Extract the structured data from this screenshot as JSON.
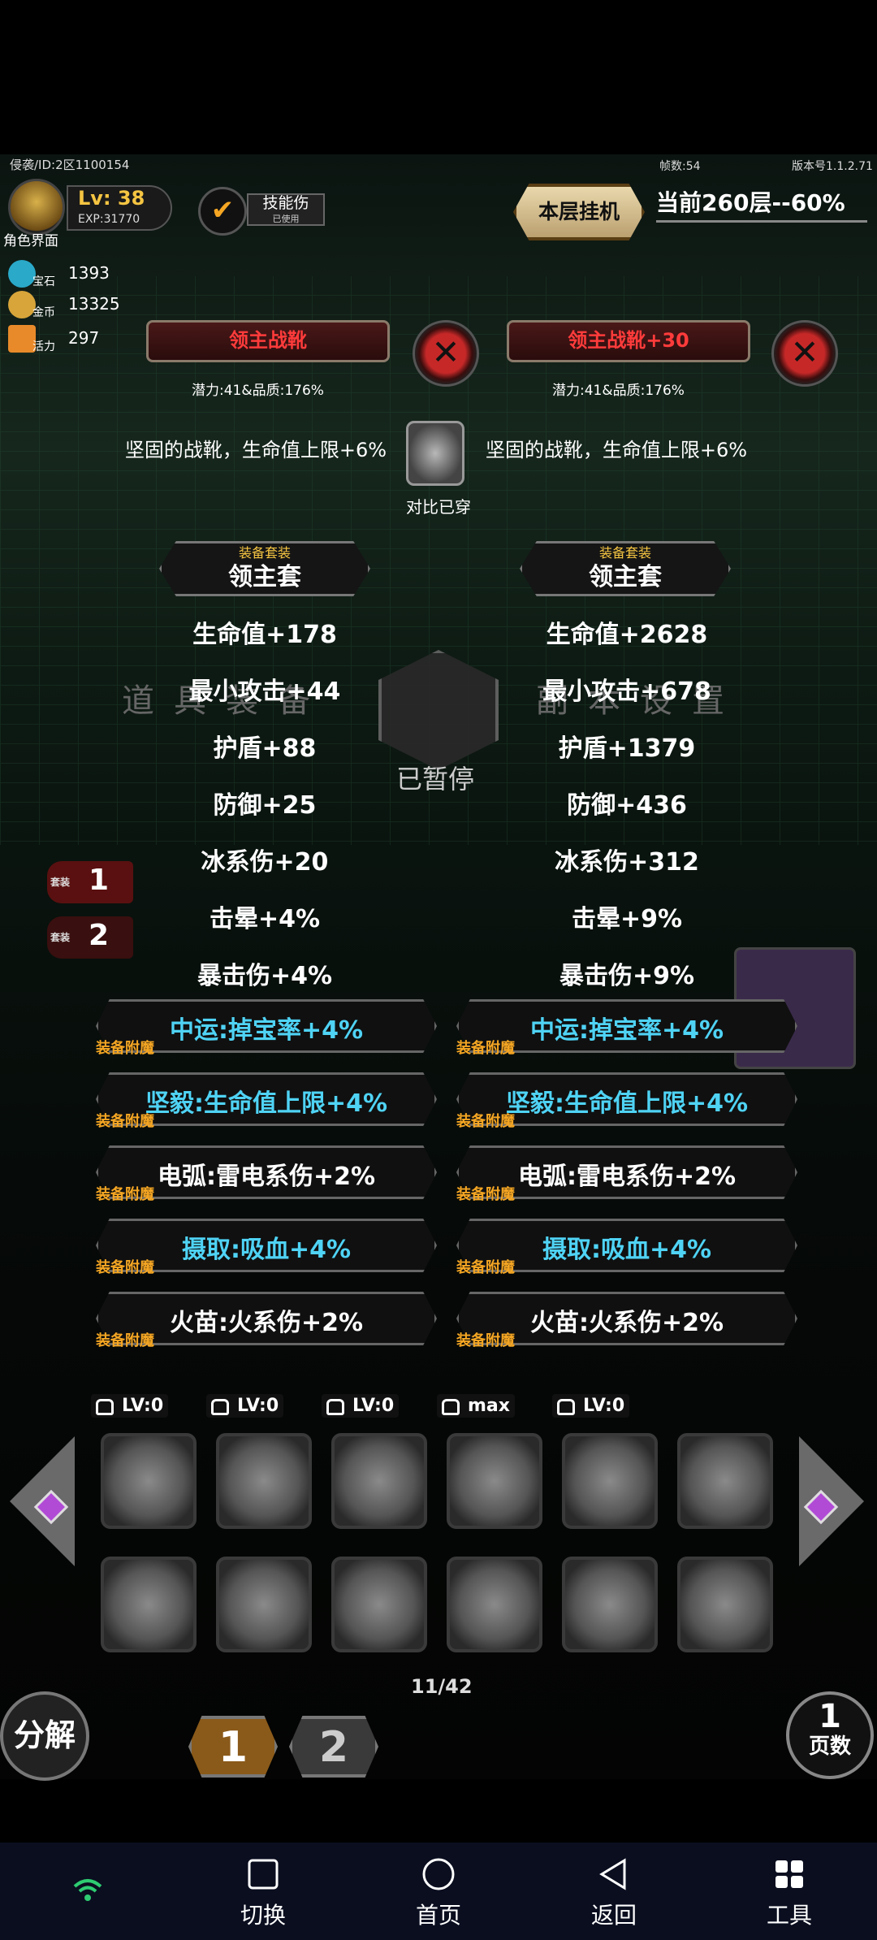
{
  "hud": {
    "id_line": "侵袭/ID:2区1100154",
    "avatar_label": "角色界面",
    "level": "Lv: 38",
    "exp": "EXP:31770",
    "resources": [
      {
        "name": "宝石",
        "value": "1393"
      },
      {
        "name": "金币",
        "value": "13325"
      },
      {
        "name": "活力",
        "value": "297"
      }
    ],
    "skill_btn": {
      "label": "技能伤",
      "sub": "已使用"
    },
    "hang_btn": "本层挂机",
    "fps": "帧数:54",
    "version": "版本号1.1.2.71",
    "floor": "当前260层--60%"
  },
  "compare": {
    "left": {
      "name": "领主战靴",
      "potential": "潜力:41&品质:176%",
      "desc": "坚固的战靴，生命值上限+6%",
      "set_caption": "装备套装",
      "set_name": "领主套",
      "stats": [
        "生命值+178",
        "最小攻击+44",
        "护盾+88",
        "防御+25",
        "冰系伤+20",
        "击晕+4%",
        "暴击伤+4%"
      ],
      "enchants": [
        {
          "text": "中运:掉宝率+4%",
          "color": "cyan"
        },
        {
          "text": "坚毅:生命值上限+4%",
          "color": "cyan"
        },
        {
          "text": "电弧:雷电系伤+2%",
          "color": "white"
        },
        {
          "text": "摄取:吸血+4%",
          "color": "cyan"
        },
        {
          "text": "火苗:火系伤+2%",
          "color": "white"
        }
      ]
    },
    "right": {
      "name": "领主战靴+30",
      "potential": "潜力:41&品质:176%",
      "desc": "坚固的战靴，生命值上限+6%",
      "set_caption": "装备套装",
      "set_name": "领主套",
      "stats": [
        "生命值+2628",
        "最小攻击+678",
        "护盾+1379",
        "防御+436",
        "冰系伤+312",
        "击晕+9%",
        "暴击伤+9%"
      ],
      "enchants": [
        {
          "text": "中运:掉宝率+4%",
          "color": "cyan"
        },
        {
          "text": "坚毅:生命值上限+4%",
          "color": "cyan"
        },
        {
          "text": "电弧:雷电系伤+2%",
          "color": "white"
        },
        {
          "text": "摄取:吸血+4%",
          "color": "cyan"
        },
        {
          "text": "火苗:火系伤+2%",
          "color": "white"
        }
      ]
    },
    "enchant_tag": "装备附魔",
    "compare_label": "对比已穿",
    "close_icon": "close-icon"
  },
  "pause_label": "已暂停",
  "menu_left": "道具装备",
  "menu_right": "副本设置",
  "suits": [
    {
      "num": "1",
      "label": "套装"
    },
    {
      "num": "2",
      "label": "套装"
    }
  ],
  "slot_levels": [
    "LV:0",
    "LV:0",
    "LV:0",
    "max",
    "LV:0"
  ],
  "page_count": "11/42",
  "decompose": "分解",
  "page_tabs": [
    "1",
    "2"
  ],
  "pages_btn": {
    "num": "1",
    "label": "页数"
  },
  "nav": [
    {
      "label": "切换",
      "icon": "square-icon"
    },
    {
      "label": "首页",
      "icon": "circle-icon"
    },
    {
      "label": "返回",
      "icon": "back-triangle-icon"
    },
    {
      "label": "工具",
      "icon": "grid-icon"
    }
  ],
  "colors": {
    "cyan": "#4fd3f5",
    "gold": "#f5c542",
    "red_title": "#ff3b3b"
  }
}
